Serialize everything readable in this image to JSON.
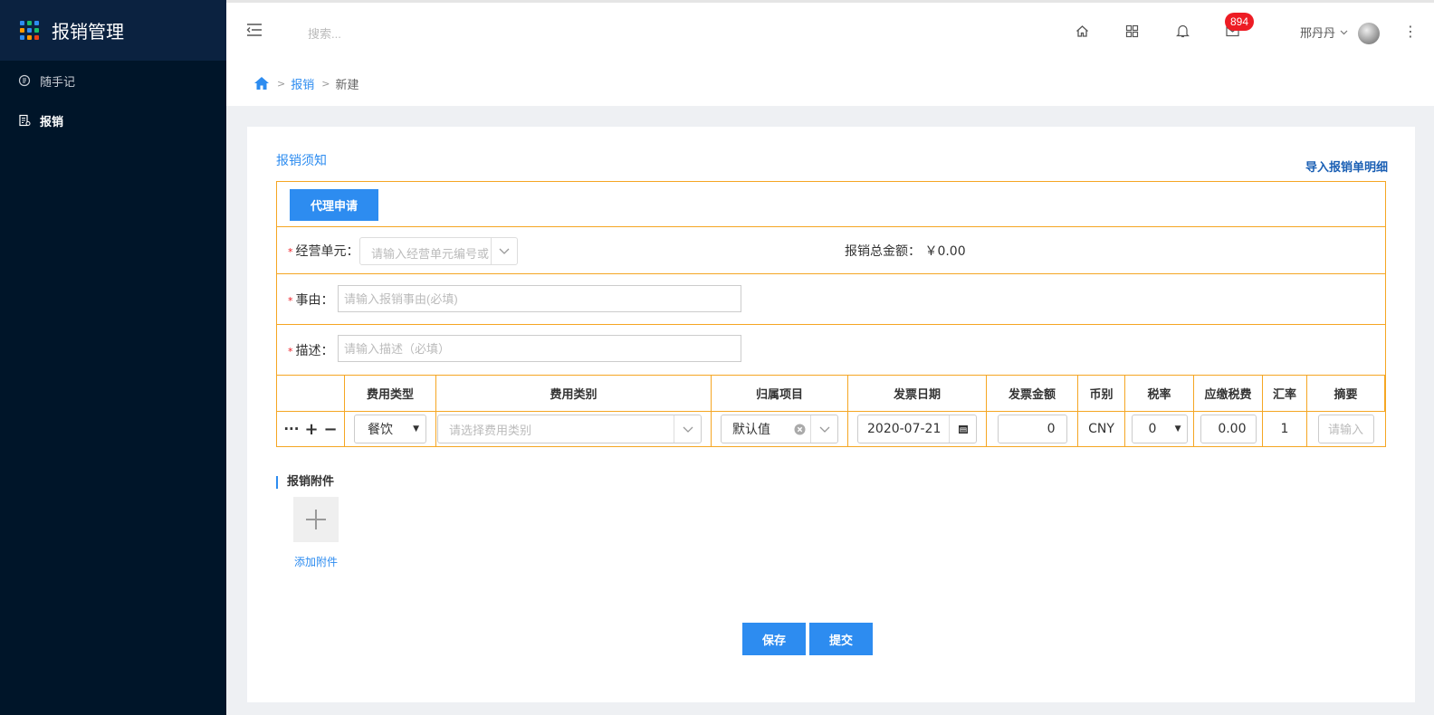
{
  "app": {
    "title": "报销管理"
  },
  "sidebar": {
    "items": [
      {
        "label": "随手记",
        "icon": "notebook-icon",
        "active": false
      },
      {
        "label": "报销",
        "icon": "receipt-icon",
        "active": true
      }
    ]
  },
  "header": {
    "search_placeholder": "搜索...",
    "mail_badge": "894",
    "user_name": "邢丹丹"
  },
  "breadcrumb": {
    "sep1": ">",
    "sep2": ">",
    "items": [
      "报销",
      "新建"
    ]
  },
  "page": {
    "notice_label": "报销须知",
    "import_link": "导入报销单明细",
    "agent_button": "代理申请",
    "business_unit": {
      "label": "经营单元：",
      "required_mark": "*",
      "placeholder": "请输入经营单元编号或..."
    },
    "total": {
      "label": "报销总金额：",
      "value": "￥0.00"
    },
    "reason": {
      "label": "事由：",
      "required_mark": "*",
      "placeholder": "请输入报销事由(必填)"
    },
    "description": {
      "label": "描述：",
      "required_mark": "*",
      "placeholder": "请输入描述（必填）"
    }
  },
  "table": {
    "headers": [
      "",
      "费用类型",
      "费用类别",
      "归属项目",
      "发票日期",
      "发票金额",
      "币别",
      "税率",
      "应缴税费",
      "汇率",
      "摘要"
    ],
    "row": {
      "actions": {
        "more": "···",
        "add": "+",
        "remove": "−"
      },
      "expense_type": "餐饮",
      "expense_category_placeholder": "请选择费用类别",
      "project": "默认值",
      "invoice_date": "2020-07-21",
      "invoice_amount": "0",
      "currency": "CNY",
      "tax_rate": "0",
      "tax_payable": "0.00",
      "exchange_rate": "1",
      "summary_placeholder": "请输入"
    }
  },
  "attachments": {
    "title": "报销附件",
    "add_label": "添加附件"
  },
  "footer": {
    "save_label": "保存",
    "submit_label": "提交"
  },
  "colors": {
    "accent": "#2d8cf0",
    "sidebar_bg": "#001529",
    "table_border": "#f5a623",
    "badge": "#ed1c24"
  }
}
